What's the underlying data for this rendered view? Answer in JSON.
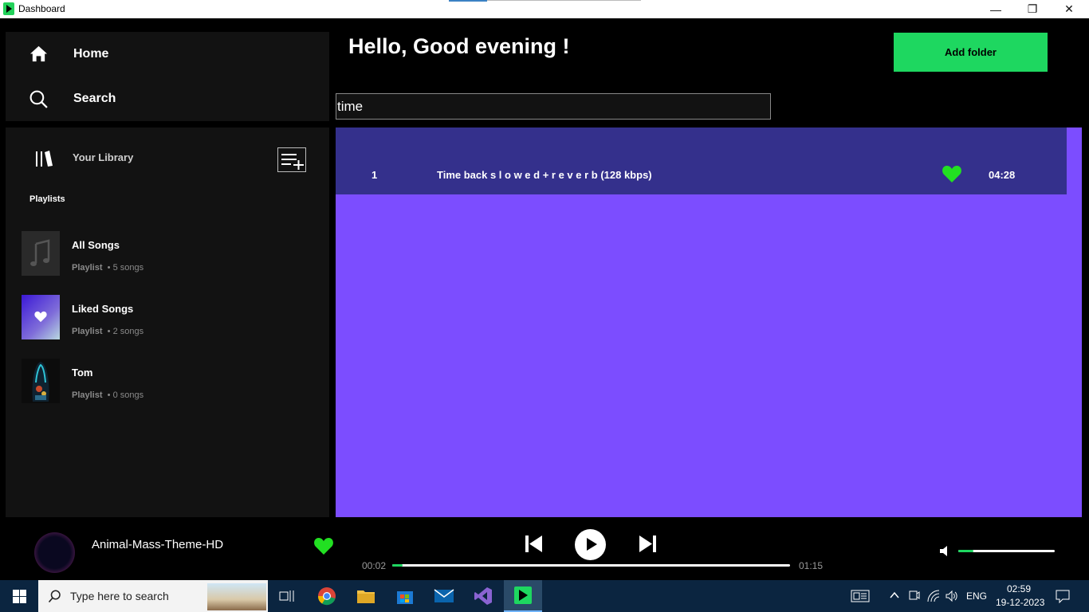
{
  "window": {
    "title": "Dashboard",
    "minimize": "—",
    "maximize": "❐",
    "close": "✕"
  },
  "nav": {
    "home": "Home",
    "search": "Search"
  },
  "library": {
    "title": "Your Library",
    "playlists_header": "Playlists",
    "playlists": [
      {
        "name": "All Songs",
        "type": "Playlist",
        "count": "5 songs"
      },
      {
        "name": "Liked Songs",
        "type": "Playlist",
        "count": "2 songs"
      },
      {
        "name": "Tom",
        "type": "Playlist",
        "count": "0 songs"
      }
    ]
  },
  "main": {
    "greeting": "Hello, Good evening !",
    "add_folder": "Add folder",
    "search_value": "time",
    "results": [
      {
        "index": "1",
        "title": "Time back   s l o w e d + r e v e r b (128 kbps)",
        "liked": true,
        "duration": "04:28"
      }
    ]
  },
  "player": {
    "title": "Animal-Mass-Theme-HD",
    "elapsed": "00:02",
    "total": "01:15",
    "progress": 0.027,
    "volume": 0.16
  },
  "taskbar": {
    "search_placeholder": "Type here to search",
    "lang": "ENG",
    "time": "02:59",
    "date": "19-12-2023"
  },
  "colors": {
    "accent": "#1ed760",
    "results_bg": "#7c4dff",
    "row_bg": "#34308c",
    "heart": "#22e022"
  }
}
